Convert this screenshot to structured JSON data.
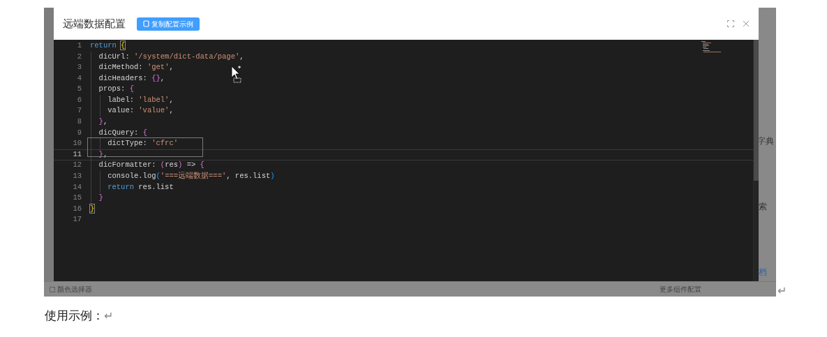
{
  "dialog": {
    "title": "远端数据配置",
    "copy_button": "复制配置示例"
  },
  "editor": {
    "lines": [
      {
        "number": "1",
        "current": false,
        "tokens": [
          {
            "kind": "keyword",
            "text": "return "
          },
          {
            "kind": "brace-match",
            "text": "{"
          }
        ]
      },
      {
        "number": "2",
        "current": false,
        "tokens": [
          {
            "kind": "plain",
            "text": "  dicUrl: "
          },
          {
            "kind": "string",
            "text": "'/system/dict-data/page'"
          },
          {
            "kind": "plain",
            "text": ","
          }
        ]
      },
      {
        "number": "3",
        "current": false,
        "tokens": [
          {
            "kind": "plain",
            "text": "  dicMethod: "
          },
          {
            "kind": "string",
            "text": "'get'"
          },
          {
            "kind": "plain",
            "text": ","
          }
        ]
      },
      {
        "number": "4",
        "current": false,
        "tokens": [
          {
            "kind": "plain",
            "text": "  dicHeaders: "
          },
          {
            "kind": "brace-purple",
            "text": "{}"
          },
          {
            "kind": "plain",
            "text": ","
          }
        ]
      },
      {
        "number": "5",
        "current": false,
        "tokens": [
          {
            "kind": "plain",
            "text": "  props: "
          },
          {
            "kind": "brace-purple",
            "text": "{"
          }
        ]
      },
      {
        "number": "6",
        "current": false,
        "tokens": [
          {
            "kind": "plain",
            "text": "    label: "
          },
          {
            "kind": "string",
            "text": "'label'"
          },
          {
            "kind": "plain",
            "text": ","
          }
        ]
      },
      {
        "number": "7",
        "current": false,
        "tokens": [
          {
            "kind": "plain",
            "text": "    value: "
          },
          {
            "kind": "string",
            "text": "'value'"
          },
          {
            "kind": "plain",
            "text": ","
          }
        ]
      },
      {
        "number": "8",
        "current": false,
        "tokens": [
          {
            "kind": "brace-purple",
            "text": "  }"
          },
          {
            "kind": "plain",
            "text": ","
          }
        ]
      },
      {
        "number": "9",
        "current": false,
        "tokens": [
          {
            "kind": "plain",
            "text": "  dicQuery: "
          },
          {
            "kind": "brace-purple",
            "text": "{"
          }
        ]
      },
      {
        "number": "10",
        "current": false,
        "tokens": [
          {
            "kind": "plain",
            "text": "    dictType: "
          },
          {
            "kind": "string",
            "text": "'cfrc'"
          }
        ]
      },
      {
        "number": "11",
        "current": true,
        "tokens": [
          {
            "kind": "brace-purple",
            "text": "  }"
          },
          {
            "kind": "plain",
            "text": ","
          }
        ]
      },
      {
        "number": "12",
        "current": false,
        "tokens": [
          {
            "kind": "plain",
            "text": "  dicFormatter: "
          },
          {
            "kind": "brace-purple",
            "text": "("
          },
          {
            "kind": "plain",
            "text": "res"
          },
          {
            "kind": "brace-purple",
            "text": ")"
          },
          {
            "kind": "plain",
            "text": " => "
          },
          {
            "kind": "brace-purple",
            "text": "{"
          }
        ]
      },
      {
        "number": "13",
        "current": false,
        "tokens": [
          {
            "kind": "plain",
            "text": "    console.log"
          },
          {
            "kind": "brace-blue",
            "text": "("
          },
          {
            "kind": "string",
            "text": "'===远端数据==='"
          },
          {
            "kind": "plain",
            "text": ", res.list"
          },
          {
            "kind": "brace-blue",
            "text": ")"
          }
        ]
      },
      {
        "number": "14",
        "current": false,
        "tokens": [
          {
            "kind": "keyword",
            "text": "    return"
          },
          {
            "kind": "plain",
            "text": " res.list"
          }
        ]
      },
      {
        "number": "15",
        "current": false,
        "tokens": [
          {
            "kind": "brace-purple",
            "text": "  }"
          }
        ]
      },
      {
        "number": "16",
        "current": false,
        "tokens": [
          {
            "kind": "brace-match",
            "text": "}"
          }
        ]
      },
      {
        "number": "17",
        "current": false
      }
    ]
  },
  "background": {
    "right_texts": [
      "字典",
      "索"
    ],
    "right_link": "档",
    "bottom_left": "颜色选择器",
    "bottom_right": "更多组件配置"
  },
  "image_return_mark": "↵",
  "paragraph": {
    "text": "使用示例：",
    "return_mark": "↵"
  }
}
